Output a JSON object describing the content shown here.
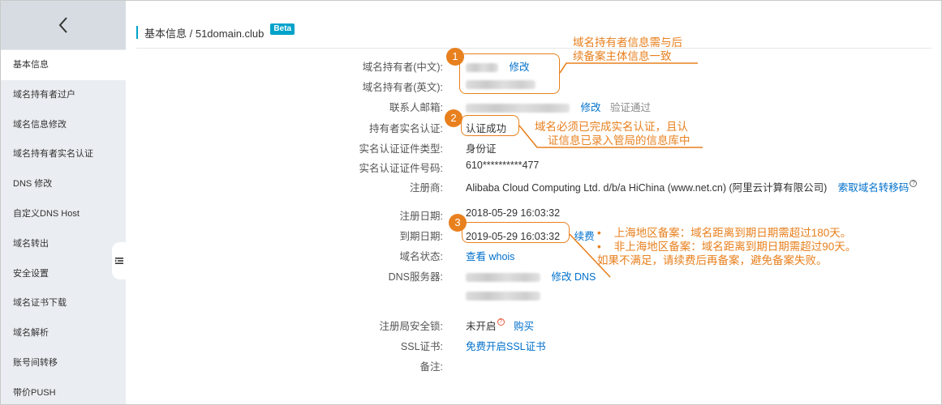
{
  "sidebar": {
    "back_icon": "chevron-left-icon",
    "items": [
      {
        "label": "基本信息"
      },
      {
        "label": "域名持有者过户"
      },
      {
        "label": "域名信息修改"
      },
      {
        "label": "域名持有者实名认证"
      },
      {
        "label": "DNS 修改"
      },
      {
        "label": "自定义DNS Host"
      },
      {
        "label": "域名转出"
      },
      {
        "label": "安全设置"
      },
      {
        "label": "域名证书下载"
      },
      {
        "label": "域名解析"
      },
      {
        "label": "账号间转移"
      },
      {
        "label": "带价PUSH"
      }
    ],
    "collapse_icon": "collapse-menu-icon"
  },
  "header": {
    "title": "基本信息 / 51domain.club",
    "badge": "Beta"
  },
  "fields": {
    "owner_cn": {
      "label": "域名持有者(中文):",
      "action": "修改"
    },
    "owner_en": {
      "label": "域名持有者(英文):"
    },
    "email": {
      "label": "联系人邮箱:",
      "action": "修改",
      "status": "验证通过"
    },
    "realname": {
      "label": "持有者实名认证:",
      "value": "认证成功"
    },
    "cert_type": {
      "label": "实名认证证件类型:",
      "value": "身份证"
    },
    "cert_no": {
      "label": "实名认证证件号码:",
      "value": "610**********477"
    },
    "registrar": {
      "label": "注册商:",
      "value": "Alibaba Cloud Computing Ltd. d/b/a HiChina (www.net.cn) (阿里云计算有限公司)",
      "action": "索取域名转移码"
    },
    "reg_date": {
      "label": "注册日期:",
      "value": "2018-05-29 16:03:32"
    },
    "exp_date": {
      "label": "到期日期:",
      "value": "2019-05-29 16:03:32",
      "action": "续费"
    },
    "status": {
      "label": "域名状态:",
      "action": "查看 whois"
    },
    "dns": {
      "label": "DNS服务器:",
      "action": "修改 DNS"
    },
    "lock": {
      "label": "注册局安全锁:",
      "value": "未开启",
      "action": "购买"
    },
    "ssl": {
      "label": "SSL证书:",
      "action": "免费开启SSL证书"
    },
    "note": {
      "label": "备注:"
    }
  },
  "annotations": {
    "color": "#e8801e",
    "a1": {
      "num": "1",
      "line1": "域名持有者信息需与后",
      "line2": "续备案主体信息一致"
    },
    "a2": {
      "num": "2",
      "line1": "域名必须已完成实名认证，且认",
      "line2": "证信息已录入管局的信息库中"
    },
    "a3": {
      "num": "3",
      "line1": "上海地区备案：域名距离到期日期需超过180天。",
      "line2": "非上海地区备案：域名距离到期日期需超过90天。",
      "line3": "如果不满足，请续费后再备案，避免备案失败。"
    }
  },
  "colors": {
    "accent": "#00a2ca",
    "link": "#0070cc",
    "sidebar_bg": "#eaedf1"
  }
}
